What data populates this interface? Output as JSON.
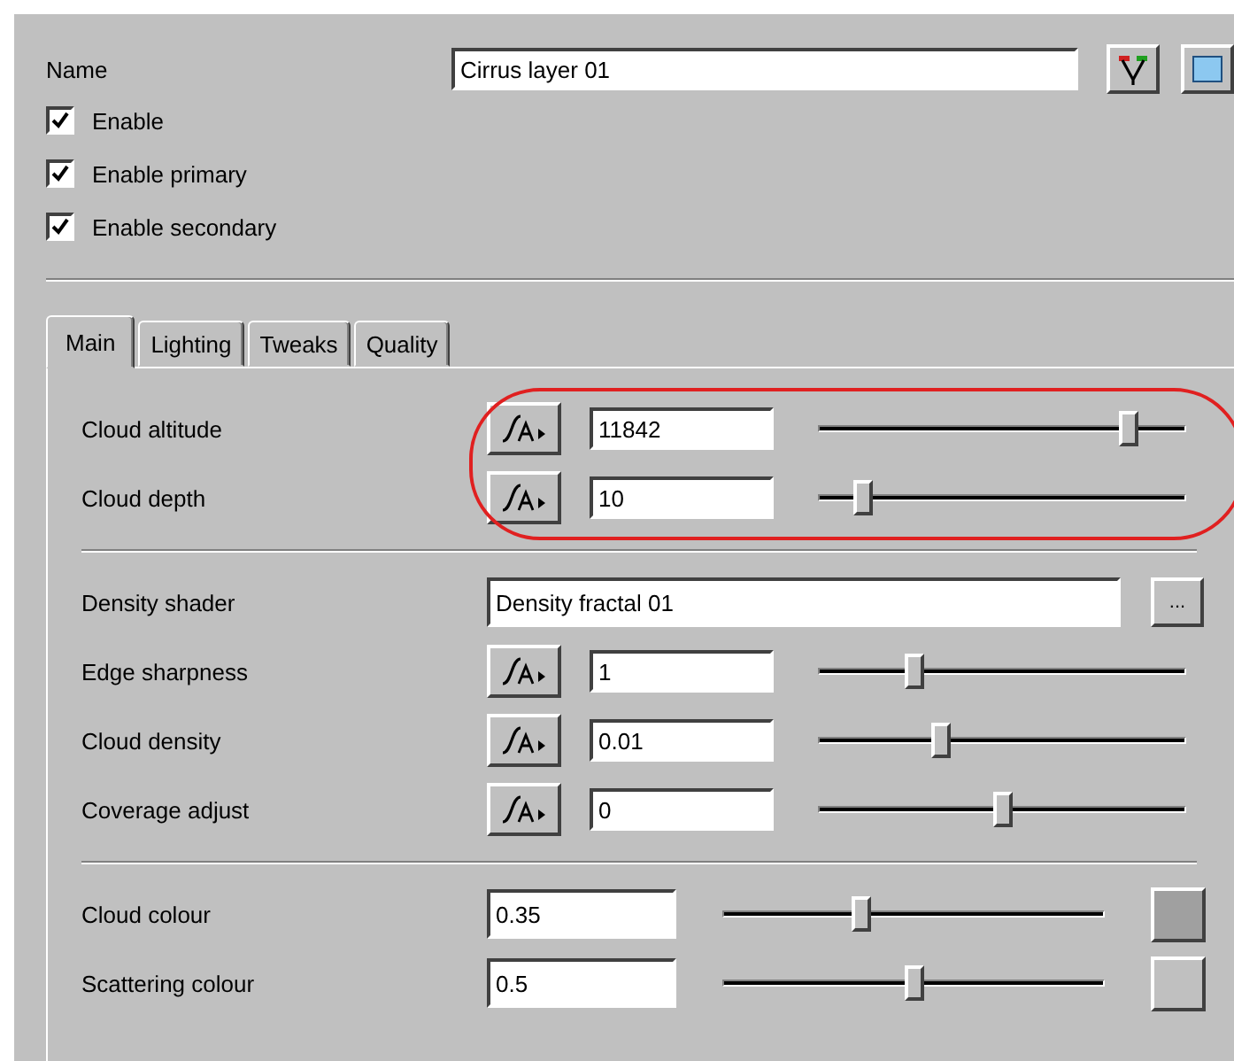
{
  "name_field": {
    "label": "Name",
    "value": "Cirrus layer 01"
  },
  "toggles": [
    {
      "label": "Enable",
      "checked": true
    },
    {
      "label": "Enable primary",
      "checked": true
    },
    {
      "label": "Enable secondary",
      "checked": true
    }
  ],
  "tabs": [
    {
      "label": "Main",
      "selected": true
    },
    {
      "label": "Lighting",
      "selected": false
    },
    {
      "label": "Tweaks",
      "selected": false
    },
    {
      "label": "Quality",
      "selected": false
    }
  ],
  "sections": [
    {
      "highlighted": true,
      "rows": [
        {
          "kind": "animated_slider",
          "label": "Cloud altitude",
          "value": "11842",
          "level": 0.84
        },
        {
          "kind": "animated_slider",
          "label": "Cloud depth",
          "value": "10",
          "level": 0.12
        }
      ]
    },
    {
      "highlighted": false,
      "rows": [
        {
          "kind": "shader",
          "label": "Density shader",
          "value": "Density fractal 01",
          "button": "..."
        },
        {
          "kind": "animated_slider",
          "label": "Edge sharpness",
          "value": "1",
          "level": 0.26
        },
        {
          "kind": "animated_slider",
          "label": "Cloud density",
          "value": "0.01",
          "level": 0.33
        },
        {
          "kind": "animated_slider",
          "label": "Coverage adjust",
          "value": "0",
          "level": 0.5
        }
      ]
    },
    {
      "highlighted": false,
      "rows": [
        {
          "kind": "colour",
          "label": "Cloud colour",
          "value": "0.35",
          "level": 0.36,
          "color": "#a0a0a0"
        },
        {
          "kind": "colour",
          "label": "Scattering colour",
          "value": "0.5",
          "level": 0.5,
          "color": "#c0c0c0"
        }
      ]
    }
  ]
}
